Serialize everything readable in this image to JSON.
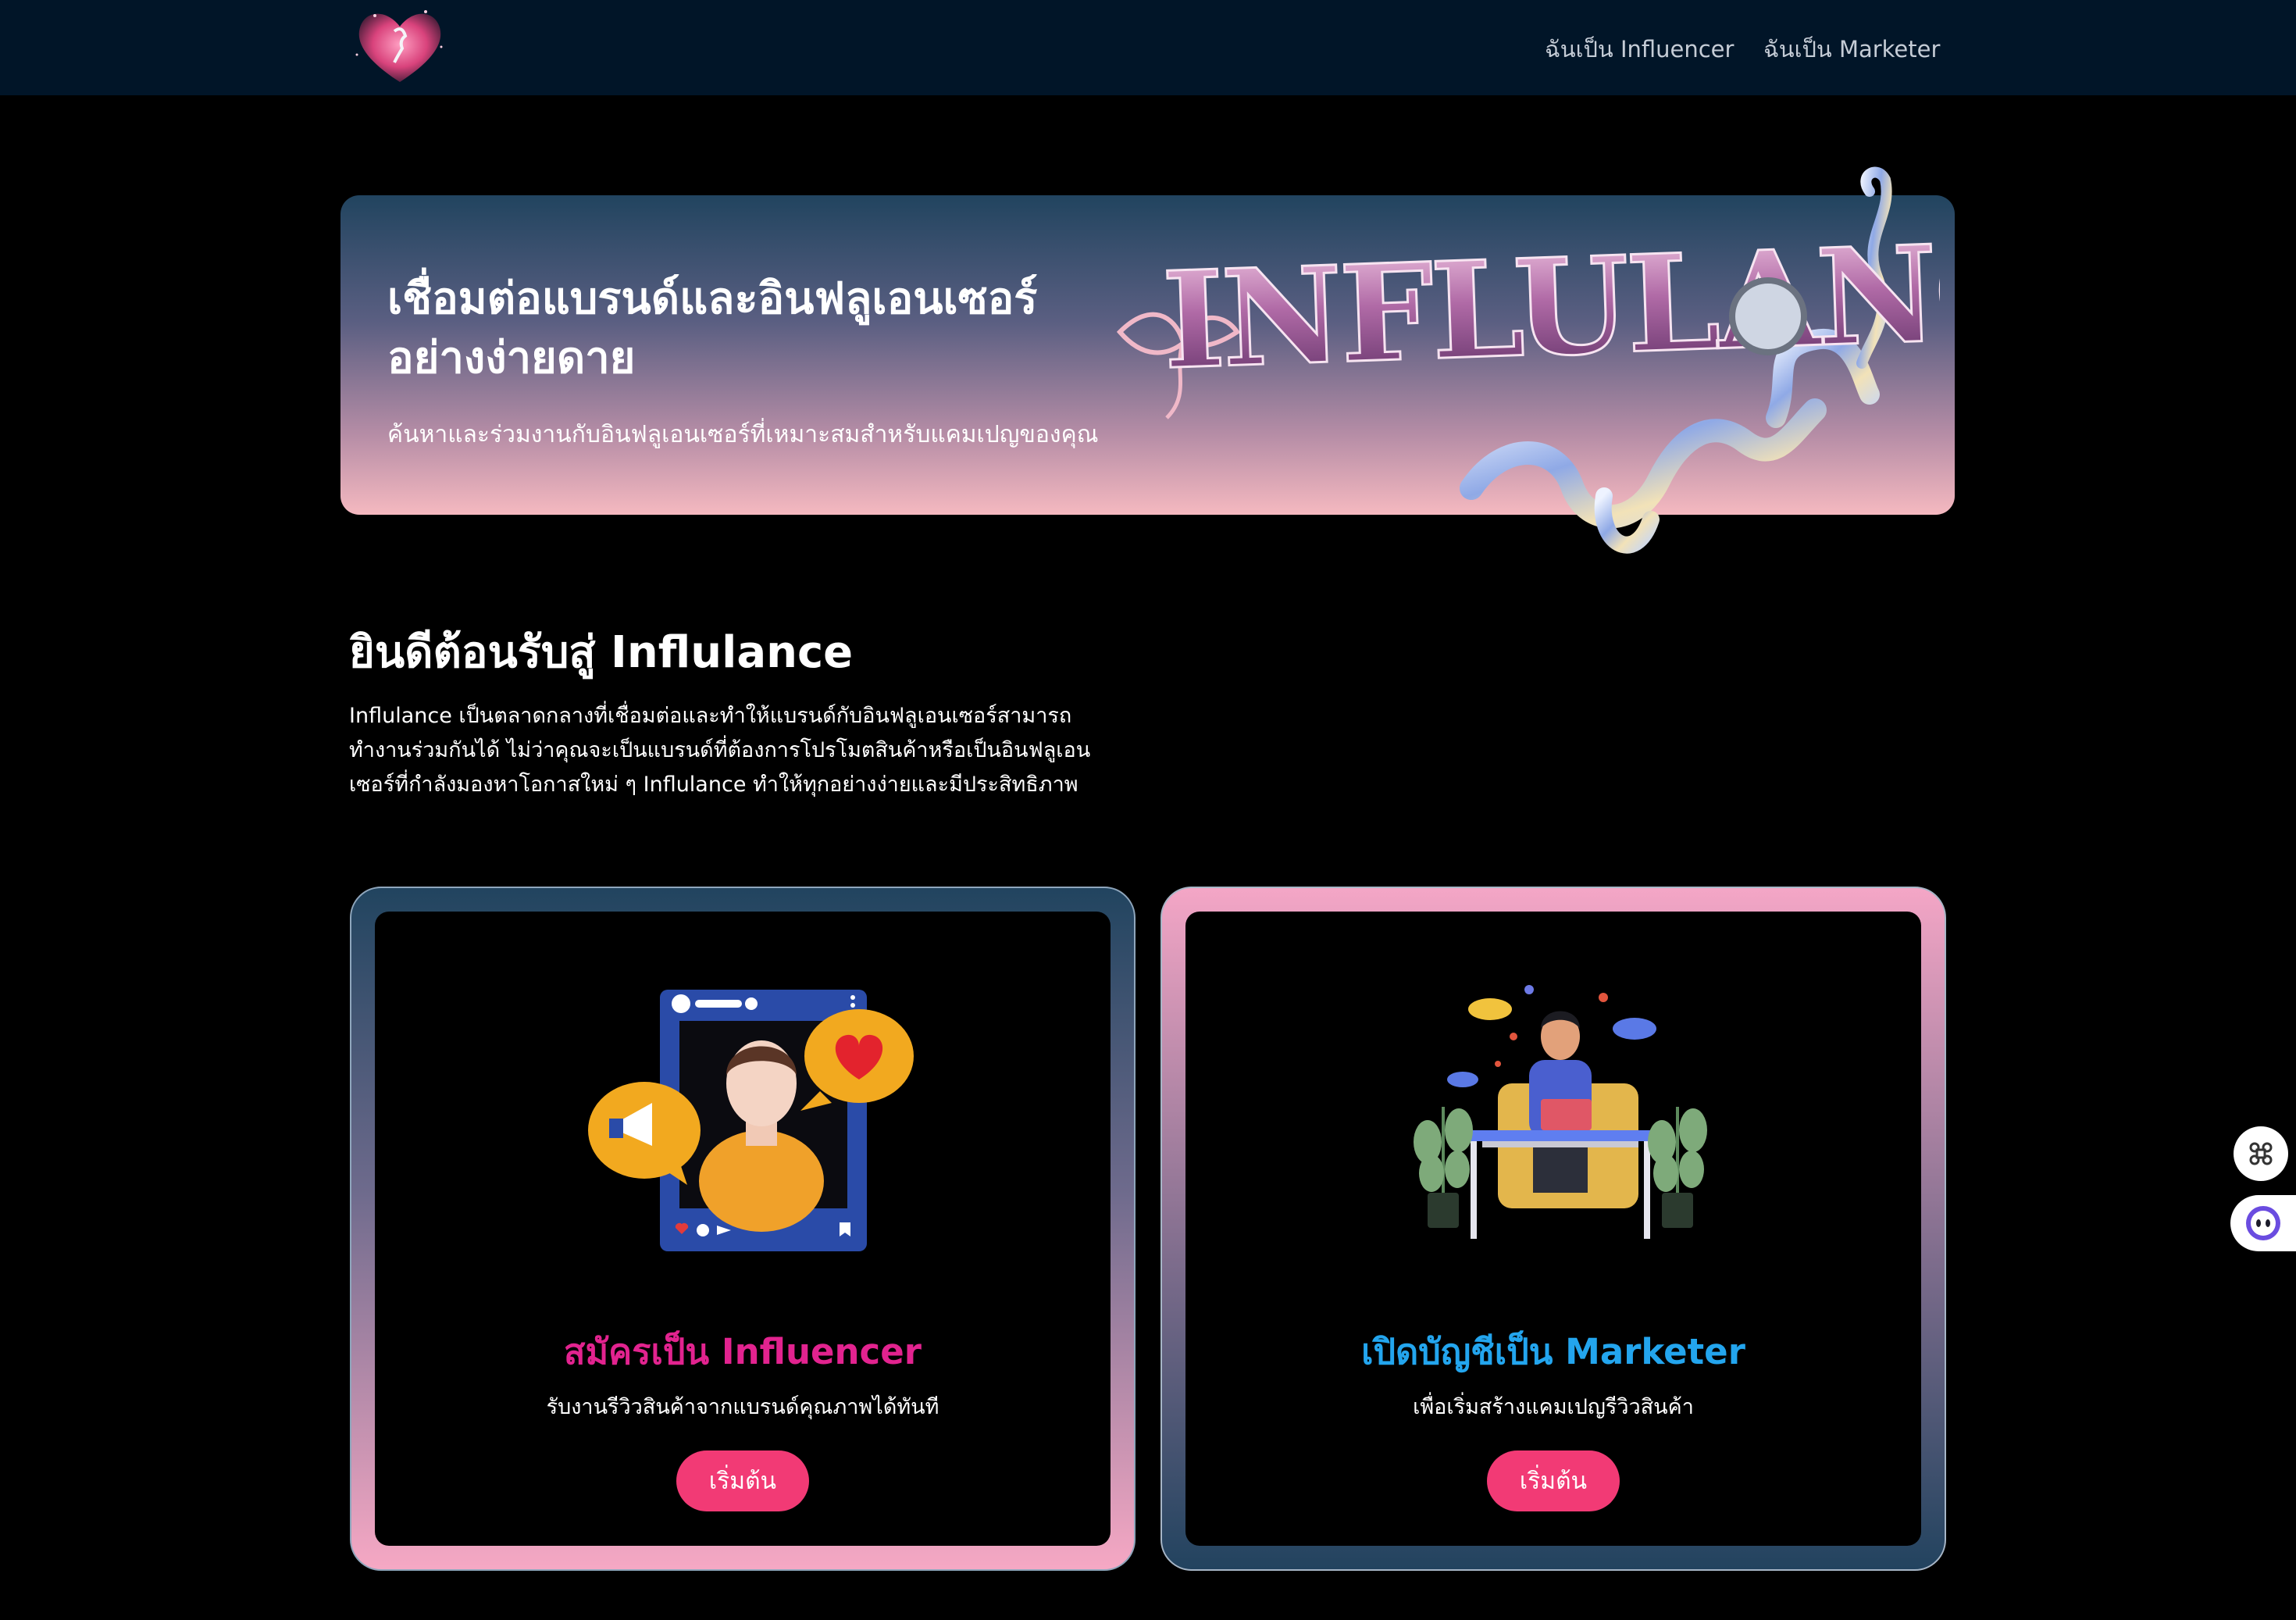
{
  "nav": {
    "logo_icon": "heart-logo-icon",
    "links": [
      "ฉันเป็น Influencer",
      "ฉันเป็น Marketer"
    ]
  },
  "hero": {
    "title": "เชื่อมต่อแบรนด์และอินฟลูเอนเซอร์อย่างง่ายดาย",
    "subtitle": "ค้นหาและร่วมงานกับอินฟลูเอนเซอร์ที่เหมาะสมสำหรับแคมเปญของคุณ",
    "wordmark": "INFLULANCE"
  },
  "welcome": {
    "title": "ยินดีต้อนรับสู่ Influlance",
    "body": "Influlance เป็นตลาดกลางที่เชื่อมต่อและทำให้แบรนด์กับอินฟลูเอนเซอร์สามารถทำงานร่วมกันได้ ไม่ว่าคุณจะเป็นแบรนด์ที่ต้องการโปรโมตสินค้าหรือเป็นอินฟลูเอนเซอร์ที่กำลังมองหาโอกาสใหม่ ๆ Influlance ทำให้ทุกอย่างง่ายและมีประสิทธิภาพ"
  },
  "cards": {
    "influencer": {
      "title": "สมัครเป็น Influencer",
      "description": "รับงานรีวิวสินค้าจากแบรนด์คุณภาพได้ทันที",
      "button": "เริ่มต้น",
      "illustration": "influencer-social-frame-illustration"
    },
    "marketer": {
      "title": "เปิดบัญชีเป็น Marketer",
      "description": "เพื่อเริ่มสร้างแคมเปญรีวิวสินค้า",
      "button": "เริ่มต้น",
      "illustration": "marketer-desk-illustration"
    }
  },
  "widgets": [
    "command-icon",
    "assistant-face-icon"
  ],
  "colors": {
    "navbar": "#011528",
    "accent_pink": "#e2238f",
    "accent_blue": "#23a5ee",
    "button": "#f23a75"
  }
}
